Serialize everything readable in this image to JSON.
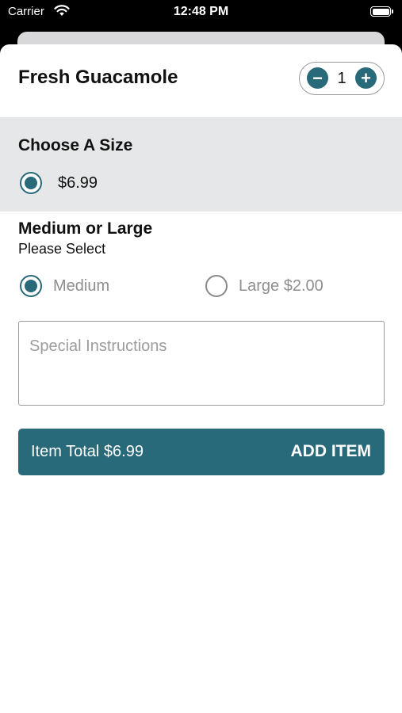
{
  "status_bar": {
    "carrier": "Carrier",
    "time": "12:48 PM",
    "wifi_icon": "wifi-icon",
    "battery_icon": "battery-icon"
  },
  "item": {
    "title": "Fresh Guacamole",
    "quantity": "1",
    "minus_symbol": "−",
    "plus_symbol": "+"
  },
  "size_section": {
    "title": "Choose A Size",
    "options": [
      {
        "label": "$6.99",
        "selected": true
      }
    ]
  },
  "size_choice": {
    "title": "Medium or Large",
    "subtitle": "Please Select",
    "options": [
      {
        "label": "Medium",
        "selected": true
      },
      {
        "label": "Large $2.00",
        "selected": false
      }
    ]
  },
  "instructions": {
    "placeholder": "Special Instructions"
  },
  "add_bar": {
    "total_label": "Item Total $6.99",
    "add_label": "ADD ITEM"
  },
  "colors": {
    "accent": "#28697a",
    "section_bg": "#e6e7e8"
  }
}
